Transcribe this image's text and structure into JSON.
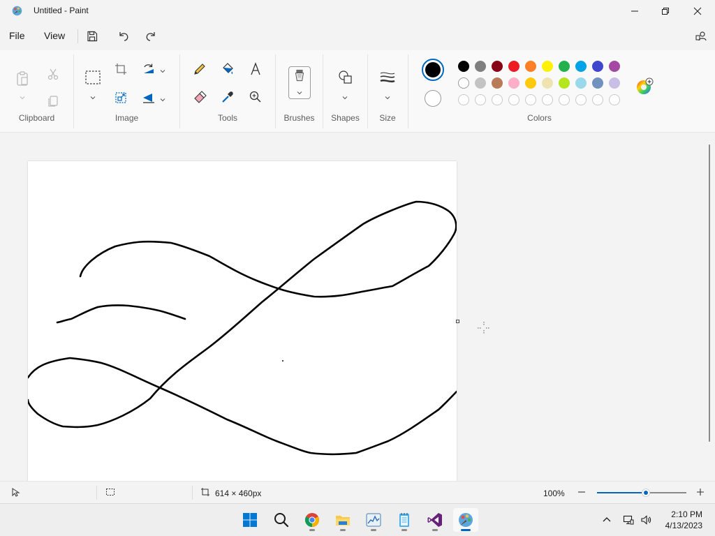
{
  "window": {
    "title": "Untitled - Paint",
    "minimize_icon": "minimize-icon",
    "maximize_icon": "restore-icon",
    "close_icon": "close-icon"
  },
  "menu": {
    "file": "File",
    "view": "View",
    "quick_actions": [
      "save-icon",
      "undo-icon",
      "redo-icon"
    ],
    "account_icon": "account-icon"
  },
  "ribbon": {
    "groups": {
      "clipboard": "Clipboard",
      "image": "Image",
      "tools": "Tools",
      "brushes": "Brushes",
      "shapes": "Shapes",
      "size": "Size",
      "colors": "Colors"
    },
    "tools": [
      "pencil-icon",
      "fill-icon",
      "text-icon",
      "eraser-icon",
      "color-picker-icon",
      "magnifier-icon"
    ],
    "primary_color": "#000000",
    "secondary_color": "#ffffff",
    "palette_row1": [
      "#000000",
      "#7f7f7f",
      "#880015",
      "#ed1c24",
      "#ff7f27",
      "#fff200",
      "#22b14c",
      "#00a2e8",
      "#3f48cc",
      "#a349a4"
    ],
    "palette_row2": [
      "#ffffff",
      "#c3c3c3",
      "#b97a57",
      "#ffaec9",
      "#ffc90e",
      "#efe4b0",
      "#b5e61d",
      "#99d9ea",
      "#7092be",
      "#c8bfe7"
    ],
    "palette_row3": [
      "",
      "",
      "",
      "",
      "",
      "",
      "",
      "",
      "",
      ""
    ],
    "edit_colors_icon": "edit-colors-icon"
  },
  "canvas": {
    "background": "#ffffff",
    "stroke_color": "#000000"
  },
  "status": {
    "canvas_size": "614 × 460px",
    "zoom": "100%"
  },
  "taskbar": {
    "apps": [
      "windows-start-icon",
      "search-icon",
      "chrome-icon",
      "file-explorer-icon",
      "task-manager-icon",
      "notepad-icon",
      "visual-studio-icon",
      "paint-icon"
    ],
    "time": "2:10 PM",
    "date": "4/13/2023"
  }
}
